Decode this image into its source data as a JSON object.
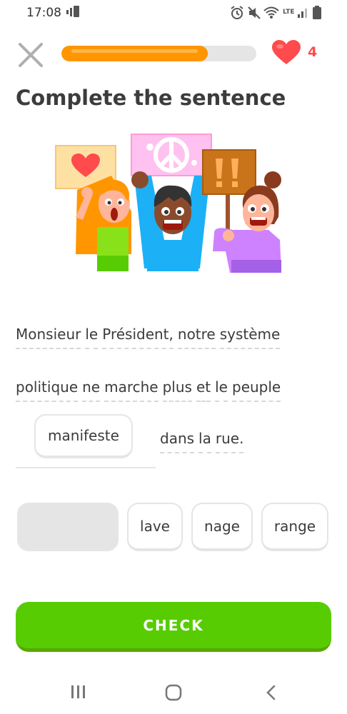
{
  "status_bar": {
    "time": "17:08",
    "network_label": "LTE"
  },
  "header": {
    "progress_fraction": 0.75,
    "hearts_count": "4"
  },
  "exercise": {
    "title": "Complete the sentence",
    "sentence_line1": [
      "Monsieur",
      "le",
      "Président,",
      "notre",
      "système"
    ],
    "sentence_line2": [
      "politique",
      "ne",
      "marche",
      "plus",
      "et",
      "le",
      "peuple"
    ],
    "selected_answer": "manifeste",
    "sentence_line3": [
      "dans",
      "la",
      "rue."
    ]
  },
  "word_bank": {
    "options": [
      "lave",
      "nage",
      "range"
    ]
  },
  "actions": {
    "check_label": "CHECK"
  },
  "colors": {
    "accent_green": "#58cc02",
    "progress_orange": "#ff9600",
    "heart_red": "#ff4b4b"
  },
  "icons": {
    "close": "close-icon",
    "heart": "heart-icon",
    "nav_recents": "recent-apps-icon",
    "nav_home": "home-icon",
    "nav_back": "back-icon"
  }
}
